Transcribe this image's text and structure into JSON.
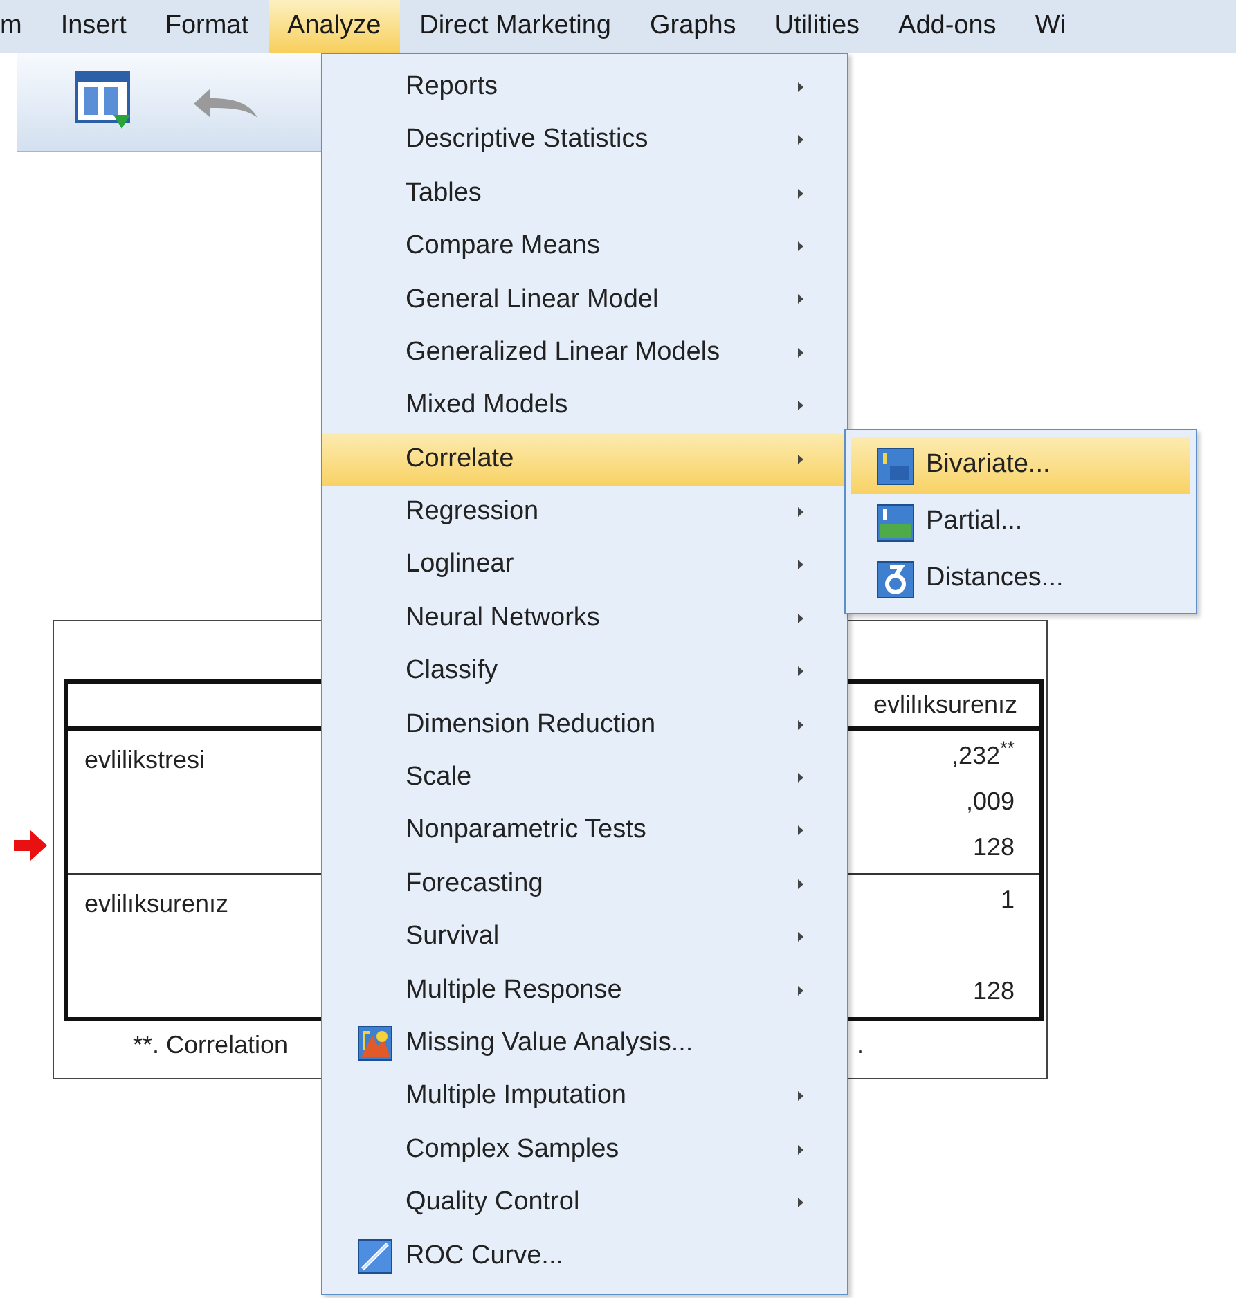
{
  "menubar": [
    {
      "label": "m",
      "selected": false
    },
    {
      "label": "Insert",
      "selected": false
    },
    {
      "label": "Format",
      "selected": false
    },
    {
      "label": "Analyze",
      "selected": true
    },
    {
      "label": "Direct Marketing",
      "selected": false
    },
    {
      "label": "Graphs",
      "selected": false
    },
    {
      "label": "Utilities",
      "selected": false
    },
    {
      "label": "Add-ons",
      "selected": false
    },
    {
      "label": "Wi",
      "selected": false
    }
  ],
  "output_table": {
    "column_header": "evlilıksurenız",
    "groups": [
      {
        "variable": "evlilikstresi",
        "line_1": ",232$^{**}$",
        "line_2": ",009",
        "line_3": "128"
      },
      {
        "variable": "evlilıksurenız",
        "line_1": "1",
        "line_3": "128"
      }
    ],
    "footnote_start": "**. Correlation",
    "footnote_end": "."
  },
  "analyze_menu": [
    {
      "label": "Reports",
      "kind": "submenu",
      "selected": false
    },
    {
      "label": "Descriptive Statistics",
      "kind": "submenu",
      "selected": false
    },
    {
      "label": "Tables",
      "kind": "submenu",
      "selected": false
    },
    {
      "label": "Compare Means",
      "kind": "submenu",
      "selected": false
    },
    {
      "label": "General Linear Model",
      "kind": "submenu",
      "selected": false
    },
    {
      "label": "Generalized Linear Models",
      "kind": "submenu",
      "selected": false
    },
    {
      "label": "Mixed Models",
      "kind": "submenu",
      "selected": false
    },
    {
      "label": "Correlate",
      "kind": "submenu",
      "selected": true
    },
    {
      "label": "Regression",
      "kind": "submenu",
      "selected": false
    },
    {
      "label": "Loglinear",
      "kind": "submenu",
      "selected": false
    },
    {
      "label": "Neural Networks",
      "kind": "submenu",
      "selected": false
    },
    {
      "label": "Classify",
      "kind": "submenu",
      "selected": false
    },
    {
      "label": "Dimension Reduction",
      "kind": "submenu",
      "selected": false
    },
    {
      "label": "Scale",
      "kind": "submenu",
      "selected": false
    },
    {
      "label": "Nonparametric Tests",
      "kind": "submenu",
      "selected": false
    },
    {
      "label": "Forecasting",
      "kind": "submenu",
      "selected": false
    },
    {
      "label": "Survival",
      "kind": "submenu",
      "selected": false
    },
    {
      "label": "Multiple Response",
      "kind": "submenu",
      "selected": false
    },
    {
      "label": "Missing Value Analysis...",
      "kind": "command",
      "selected": false
    },
    {
      "label": "Multiple Imputation",
      "kind": "submenu",
      "selected": false
    },
    {
      "label": "Complex Samples",
      "kind": "submenu",
      "selected": false
    },
    {
      "label": "Quality Control",
      "kind": "submenu",
      "selected": false
    },
    {
      "label": "ROC Curve...",
      "kind": "command",
      "selected": false
    }
  ],
  "correlate_submenu": [
    {
      "label": "Bivariate...",
      "selected": true
    },
    {
      "label": "Partial...",
      "selected": false
    },
    {
      "label": "Distances...",
      "selected": false
    }
  ]
}
